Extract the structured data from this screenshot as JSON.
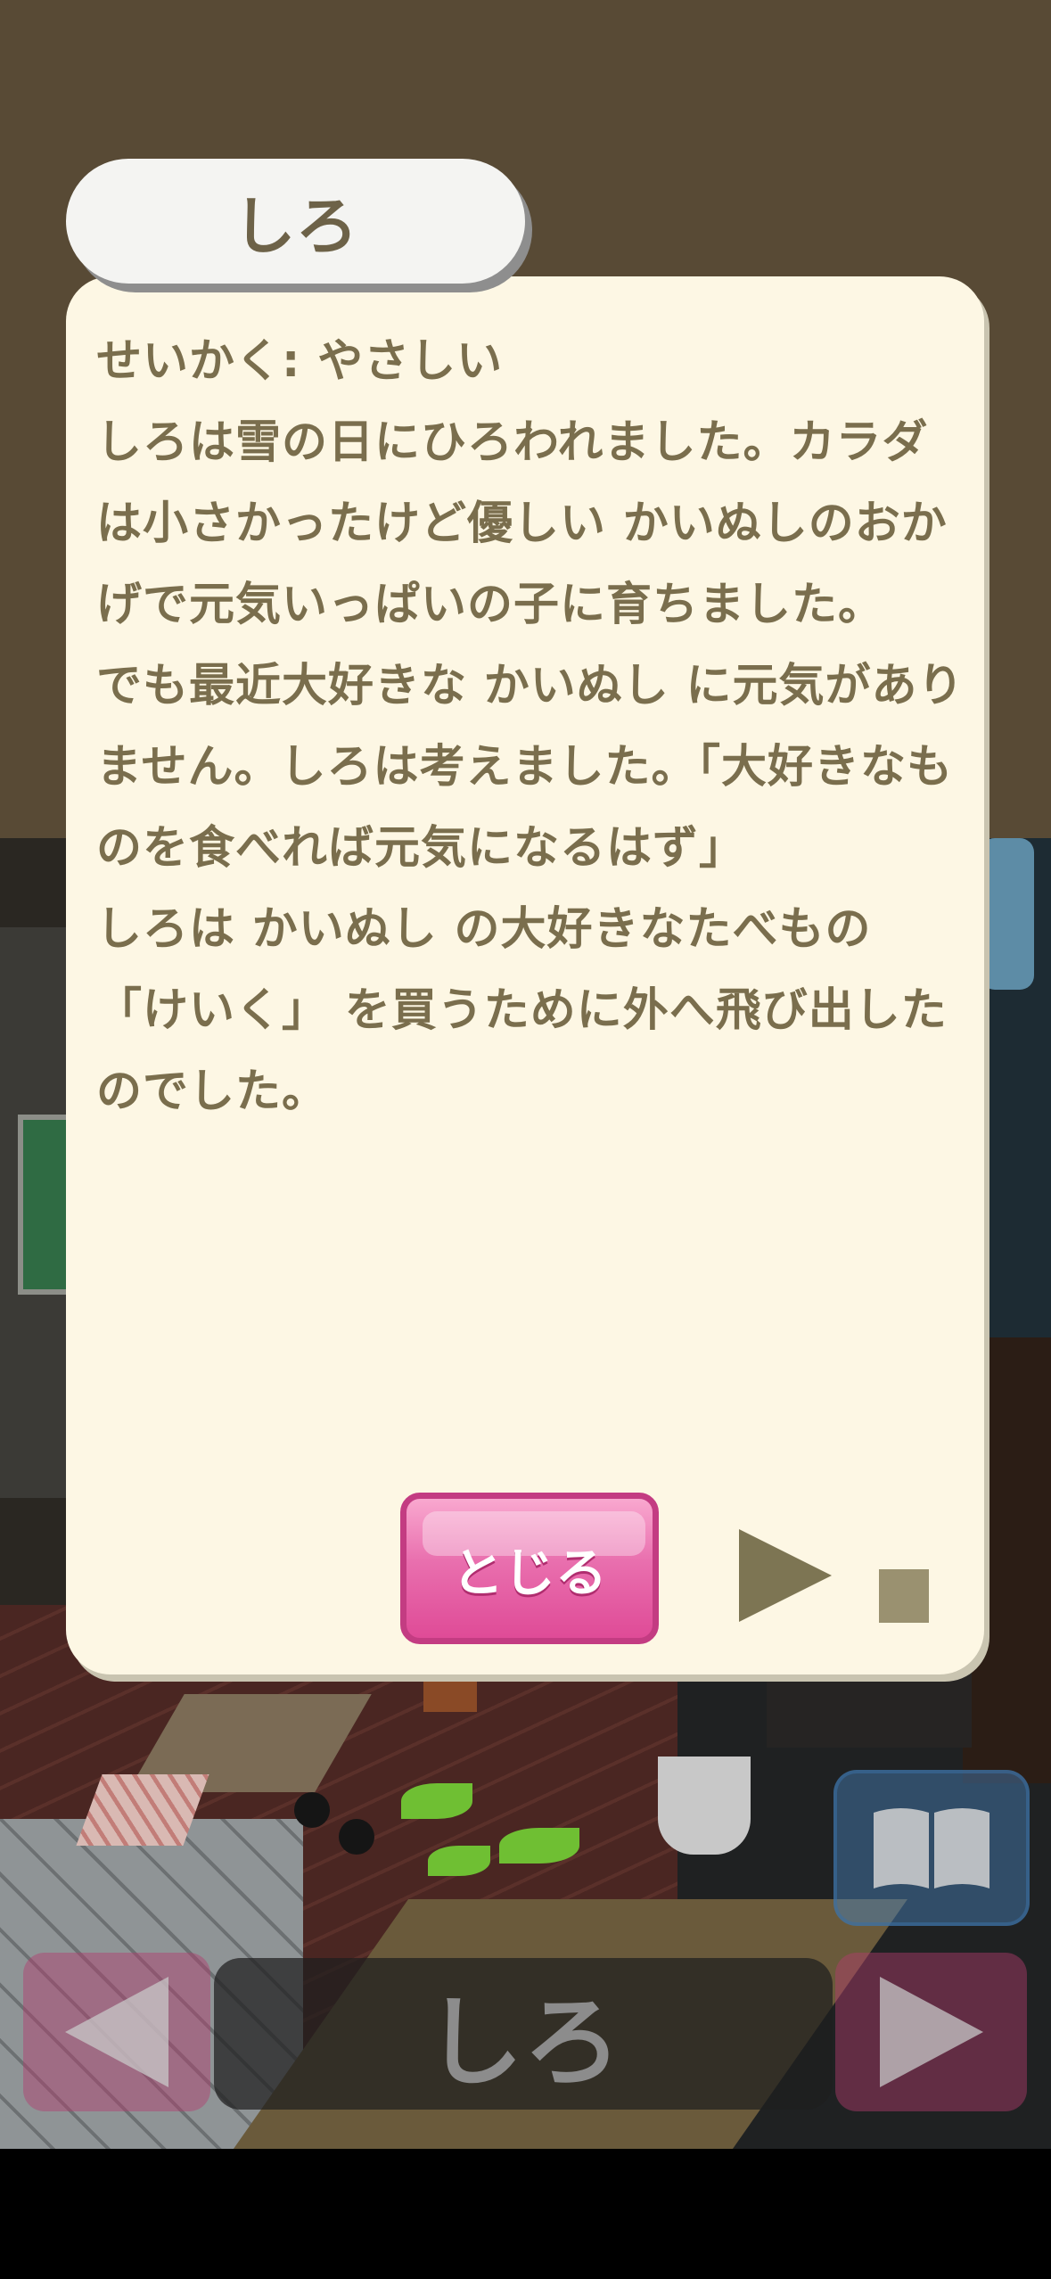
{
  "character": {
    "name": "しろ"
  },
  "story": {
    "text": "せいかく: やさしい\nしろは雪の日にひろわれました。カラダは小さかったけど優しい かいぬしのおかげで元気いっぱいの子に育ちました。\nでも最近大好きな かいぬし に元気がありません。しろは考えました。「大好きなものを食べれば元気になるはず」\nしろは かいぬし の大好きなたべもの 「けいく」 を買うために外へ飛び出したのでした。"
  },
  "buttons": {
    "close_label": "とじる"
  },
  "icons": {
    "play": "play-icon",
    "stop": "stop-icon",
    "book": "book-icon",
    "prev": "arrow-left-icon",
    "next": "arrow-right-icon"
  },
  "bottom_bar": {
    "selected_name": "しろ"
  },
  "colors": {
    "card_bg": "#fdf7e4",
    "text": "#7a6e4d",
    "close_button": "#e96fae",
    "wall": "#584a35"
  }
}
